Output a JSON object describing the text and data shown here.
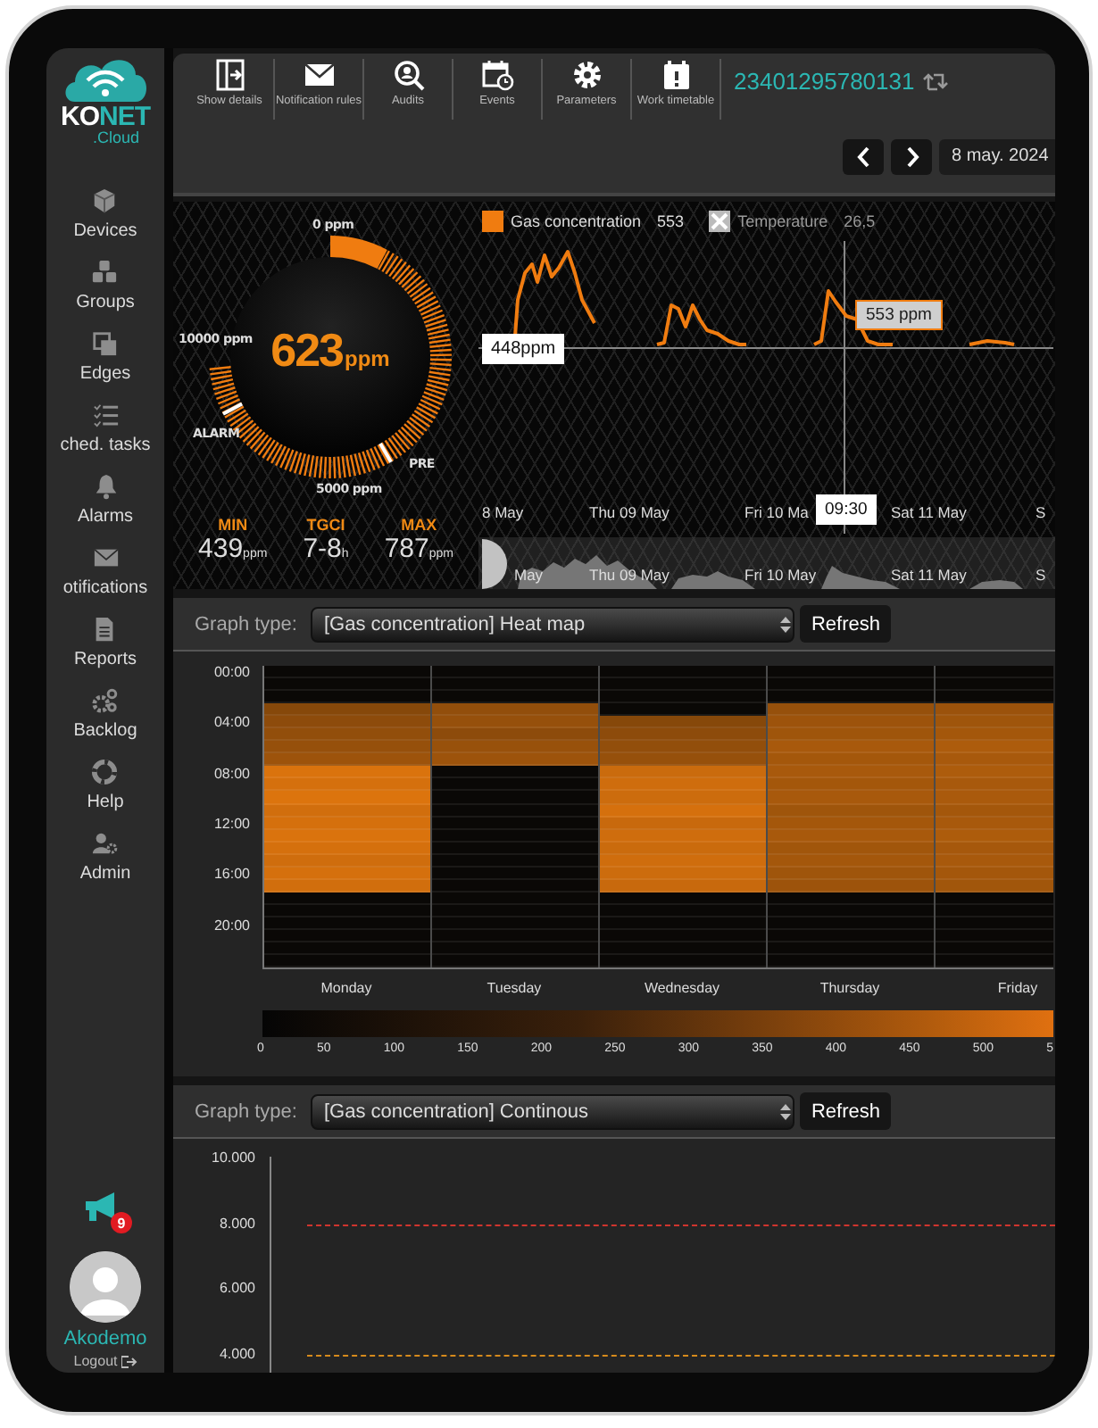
{
  "logo": {
    "name_left": "KO",
    "name_right": "NET",
    "suffix": ".Cloud"
  },
  "sidebar": {
    "items": [
      {
        "label": "Devices"
      },
      {
        "label": "Groups"
      },
      {
        "label": "Edges"
      },
      {
        "label": "ched. tasks"
      },
      {
        "label": "Alarms"
      },
      {
        "label": "otifications"
      },
      {
        "label": "Reports"
      },
      {
        "label": "Backlog"
      },
      {
        "label": "Help"
      },
      {
        "label": "Admin"
      }
    ]
  },
  "announcements_badge": "9",
  "user": {
    "name": "Akodemo",
    "logout": "Logout"
  },
  "toolbar": {
    "items": [
      {
        "label": "Show details"
      },
      {
        "label": "Notification rules"
      },
      {
        "label": "Audits"
      },
      {
        "label": "Events"
      },
      {
        "label": "Parameters"
      },
      {
        "label": "Work timetable"
      }
    ],
    "device_id": "23401295780131",
    "date": "8 may. 2024"
  },
  "gauge": {
    "value": "623",
    "unit": "ppm",
    "scale_labels": [
      "0 ppm",
      "10000 ppm",
      "5000 ppm"
    ],
    "markers": [
      "ALARM",
      "PRE"
    ],
    "stats": [
      {
        "label": "MIN",
        "value": "439",
        "unit": "ppm"
      },
      {
        "label": "TGCI",
        "value": "7-8",
        "unit": "h"
      },
      {
        "label": "MAX",
        "value": "787",
        "unit": "ppm"
      }
    ]
  },
  "line_chart": {
    "legend": [
      {
        "label": "Gas concentration",
        "value": "553",
        "visible": true
      },
      {
        "label": "Temperature",
        "value": "26,5",
        "visible": false
      }
    ],
    "marker_label": "448ppm",
    "tooltip": "553 ppm",
    "cursor_time": "09:30",
    "x_labels": [
      "8 May",
      "Thu 09 May",
      "Fri 10 Ma",
      "Sat 11 May",
      "S"
    ],
    "navigator_labels": [
      "May",
      "Thu 09 May",
      "Fri 10 May",
      "Sat 11 May",
      "S"
    ]
  },
  "heatmap": {
    "graph_type_label": "Graph type:",
    "graph_type": "[Gas concentration] Heat map",
    "refresh": "Refresh",
    "hours": [
      "00:00",
      "04:00",
      "08:00",
      "12:00",
      "16:00",
      "20:00"
    ],
    "days": [
      {
        "label": "Monday",
        "cells": [
          {
            "color": "#0a0806"
          },
          {
            "color": "#0a0806"
          },
          {
            "color": "#0a0806"
          },
          {
            "color": "#86480a"
          },
          {
            "color": "#8d4b0b"
          },
          {
            "color": "#924e0b"
          },
          {
            "color": "#96500b"
          },
          {
            "color": "#9d530b"
          },
          {
            "color": "#da730d"
          },
          {
            "color": "#d5700d"
          },
          {
            "color": "#dc740d"
          },
          {
            "color": "#d16e0d"
          },
          {
            "color": "#d5700d"
          },
          {
            "color": "#da730d"
          },
          {
            "color": "#d5700d"
          },
          {
            "color": "#cf6d0d"
          },
          {
            "color": "#d5700d"
          },
          {
            "color": "#d16e0d"
          },
          {
            "color": "#0a0806"
          },
          {
            "color": "#0a0806"
          },
          {
            "color": "#0a0806"
          },
          {
            "color": "#0a0806"
          },
          {
            "color": "#0a0806"
          },
          {
            "color": "#0a0806"
          }
        ]
      },
      {
        "label": "Tuesday",
        "cells": [
          {
            "color": "#0a0806"
          },
          {
            "color": "#0a0806"
          },
          {
            "color": "#0a0806"
          },
          {
            "color": "#924e0b"
          },
          {
            "color": "#96500b"
          },
          {
            "color": "#8d4b0b"
          },
          {
            "color": "#98510b"
          },
          {
            "color": "#9d530b"
          },
          {
            "color": "#0a0806"
          },
          {
            "color": "#0a0806"
          },
          {
            "color": "#0a0806"
          },
          {
            "color": "#0a0806"
          },
          {
            "color": "#0a0806"
          },
          {
            "color": "#0a0806"
          },
          {
            "color": "#0a0806"
          },
          {
            "color": "#0a0806"
          },
          {
            "color": "#0a0806"
          },
          {
            "color": "#0a0806"
          },
          {
            "color": "#0a0806"
          },
          {
            "color": "#0a0806"
          },
          {
            "color": "#0a0806"
          },
          {
            "color": "#0a0806"
          },
          {
            "color": "#0a0806"
          },
          {
            "color": "#0a0806"
          }
        ]
      },
      {
        "label": "Wednesday",
        "cells": [
          {
            "color": "#0a0806"
          },
          {
            "color": "#0a0806"
          },
          {
            "color": "#0a0806"
          },
          {
            "color": "#0a0806"
          },
          {
            "color": "#86480a"
          },
          {
            "color": "#8d4b0b"
          },
          {
            "color": "#924e0b"
          },
          {
            "color": "#96500b"
          },
          {
            "color": "#ca6b0d"
          },
          {
            "color": "#cf6d0d"
          },
          {
            "color": "#cc6c0d"
          },
          {
            "color": "#d5700d"
          },
          {
            "color": "#c8690d"
          },
          {
            "color": "#cf6d0d"
          },
          {
            "color": "#ca6b0d"
          },
          {
            "color": "#cf6d0d"
          },
          {
            "color": "#cc6c0d"
          },
          {
            "color": "#c8690d"
          },
          {
            "color": "#0a0806"
          },
          {
            "color": "#0a0806"
          },
          {
            "color": "#0a0806"
          },
          {
            "color": "#0a0806"
          },
          {
            "color": "#0a0806"
          },
          {
            "color": "#0a0806"
          }
        ]
      },
      {
        "label": "Thursday",
        "cells": [
          {
            "color": "#0a0806"
          },
          {
            "color": "#0a0806"
          },
          {
            "color": "#0a0806"
          },
          {
            "color": "#96500b"
          },
          {
            "color": "#9d530b"
          },
          {
            "color": "#9f550b"
          },
          {
            "color": "#a8590c"
          },
          {
            "color": "#a4570b"
          },
          {
            "color": "#a8590c"
          },
          {
            "color": "#a4570b"
          },
          {
            "color": "#a8590c"
          },
          {
            "color": "#9f550b"
          },
          {
            "color": "#a4570b"
          },
          {
            "color": "#a8590c"
          },
          {
            "color": "#a1560b"
          },
          {
            "color": "#a4570b"
          },
          {
            "color": "#9f550b"
          },
          {
            "color": "#9d530b"
          },
          {
            "color": "#0a0806"
          },
          {
            "color": "#0a0806"
          },
          {
            "color": "#0a0806"
          },
          {
            "color": "#0a0806"
          },
          {
            "color": "#0a0806"
          },
          {
            "color": "#0a0806"
          }
        ]
      },
      {
        "label": "Friday",
        "cells": [
          {
            "color": "#0a0806"
          },
          {
            "color": "#0a0806"
          },
          {
            "color": "#0a0806"
          },
          {
            "color": "#9b520b"
          },
          {
            "color": "#9f550b"
          },
          {
            "color": "#a4570b"
          },
          {
            "color": "#ad5c0c"
          },
          {
            "color": "#a8590c"
          },
          {
            "color": "#ad5c0c"
          },
          {
            "color": "#a8590c"
          },
          {
            "color": "#aa5a0c"
          },
          {
            "color": "#a4570b"
          },
          {
            "color": "#a8590c"
          },
          {
            "color": "#ad5c0c"
          },
          {
            "color": "#a6580c"
          },
          {
            "color": "#a8590c"
          },
          {
            "color": "#a4570b"
          },
          {
            "color": "#a1560b"
          },
          {
            "color": "#0a0806"
          },
          {
            "color": "#0a0806"
          },
          {
            "color": "#0a0806"
          },
          {
            "color": "#0a0806"
          },
          {
            "color": "#0a0806"
          },
          {
            "color": "#0a0806"
          }
        ]
      }
    ],
    "scale_labels": [
      "0",
      "50",
      "100",
      "150",
      "200",
      "250",
      "300",
      "350",
      "400",
      "450",
      "500",
      "5"
    ]
  },
  "continuous": {
    "graph_type_label": "Graph type:",
    "graph_type": "[Gas concentration] Continous",
    "refresh": "Refresh",
    "y_ticks": [
      {
        "label": "10.000"
      },
      {
        "label": "8.000",
        "color": "#d0352e"
      },
      {
        "label": "6.000"
      },
      {
        "label": "4.000",
        "color": "#d68a1c"
      }
    ]
  }
}
